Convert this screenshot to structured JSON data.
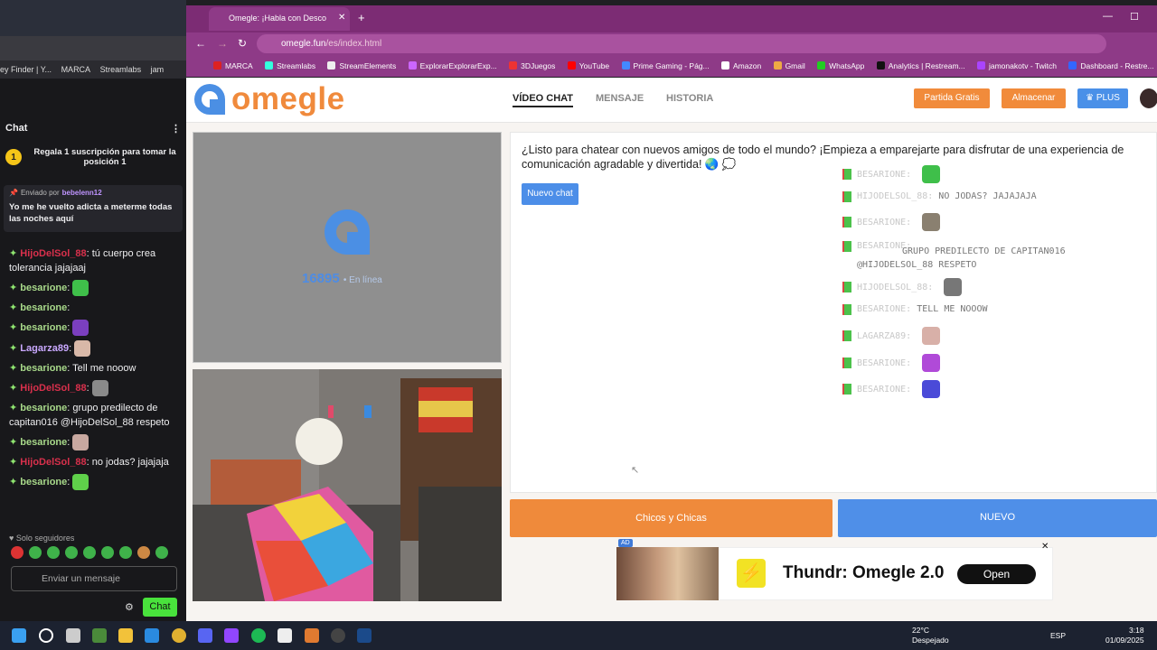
{
  "left_panel": {
    "bookmarks": [
      "ey Finder | Y...",
      "MARCA",
      "Streamlabs",
      "jam"
    ],
    "chat_header": "Chat",
    "sub_card": "Regala 1 suscripción para tomar la posición 1",
    "sub_rank": "1",
    "pinned_sent_by": "Enviado por",
    "pinned_user": "bebelenn12",
    "pinned_text": "Yo me he vuelto adicta a meterme todas las noches aquí",
    "messages": [
      {
        "user": "HijoDelSol_88",
        "text": ": tú cuerpo crea tolerancia jajajaaj"
      },
      {
        "user": "besarione",
        "text": ":"
      },
      {
        "user": "besarione",
        "text": ":"
      },
      {
        "user": "besarione",
        "text": ":"
      },
      {
        "user": "Lagarza89",
        "text": ":"
      },
      {
        "user": "besarione",
        "text": ": Tell me nooow"
      },
      {
        "user": "HijoDelSol_88",
        "text": ":"
      },
      {
        "user": "besarione",
        "text": ": grupo predilecto de capitan016 @HijoDelSol_88 respeto"
      },
      {
        "user": "besarione",
        "text": ":"
      },
      {
        "user": "HijoDelSol_88",
        "text": ": no jodas? jajajaja"
      },
      {
        "user": "besarione",
        "text": ":"
      }
    ],
    "followers_only": "Solo seguidores",
    "send_placeholder": "Enviar un mensaje",
    "chat_button": "Chat"
  },
  "browser": {
    "tab_title": "Omegle: ¡Habla con Desco",
    "url_host": "omegle.fun",
    "url_path": "/es/index.html",
    "bookmarks": [
      "MARCA",
      "Streamlabs",
      "StreamElements",
      "ExplorarExplorarExp...",
      "3DJuegos",
      "YouTube",
      "Prime Gaming - Pág...",
      "Amazon",
      "Gmail",
      "WhatsApp",
      "Analytics | Restream...",
      "jamonakotv - Twitch",
      "Dashboard - Restre..."
    ]
  },
  "site": {
    "logo": "omegle",
    "nav": {
      "video": "VÍDEO CHAT",
      "message": "MENSAJE",
      "history": "HISTORIA"
    },
    "btn_partida": "Partida Gratis",
    "btn_almacenar": "Almacenar",
    "btn_plus": "PLUS",
    "online_count": "16895",
    "online_label": "• En línea",
    "welcome": "¿Listo para chatear con nuevos amigos de todo el mundo? ¡Empieza a emparejarte para disfrutar de una experiencia de comunicación agradable y divertida! 🌏 💭",
    "btn_nuevo_chat": "Nuevo chat",
    "overlay_chat": [
      {
        "name": "BESARIONE:",
        "text": ""
      },
      {
        "name": "HIJODELSOL_88:",
        "text": "NO JODAS? JAJAJAJA"
      },
      {
        "name": "BESARIONE:",
        "text": ""
      },
      {
        "name": "BESARIONE:",
        "text": "GRUPO PREDILECTO DE CAPITAN016 @HIJODELSOL_88 RESPETO"
      },
      {
        "name": "HIJODELSOL_88:",
        "text": ""
      },
      {
        "name": "BESARIONE:",
        "text": "TELL ME NOOOW"
      },
      {
        "name": "LAGARZA89:",
        "text": ""
      },
      {
        "name": "BESARIONE:",
        "text": ""
      },
      {
        "name": "BESARIONE:",
        "text": ""
      }
    ],
    "btn_chicos": "Chicos y Chicas",
    "btn_nuevo": "NUEVO",
    "ad": {
      "tag": "AD",
      "title": "Thundr: Omegle 2.0",
      "button": "Open",
      "close": "✕"
    }
  },
  "taskbar": {
    "temperature": "22°C",
    "weather": "Despejado",
    "lang": "ESP",
    "time": "3:18",
    "date": "01/09/2025"
  }
}
